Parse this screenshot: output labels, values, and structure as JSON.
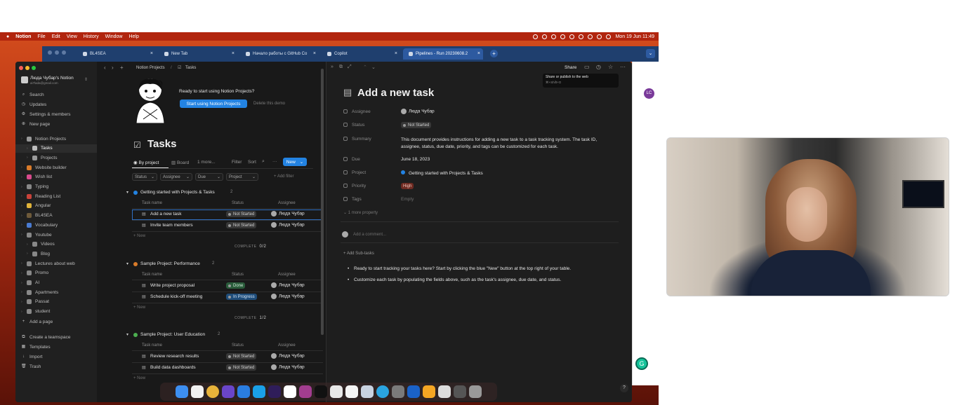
{
  "menubar": {
    "app": "Notion",
    "items": [
      "File",
      "Edit",
      "View",
      "History",
      "Window",
      "Help"
    ],
    "clock": "Mon 19 Jun  11:49"
  },
  "browser": {
    "tabs": [
      {
        "label": "BL4SEA"
      },
      {
        "label": "New Tab"
      },
      {
        "label": "Начало работы с GitHub Co"
      },
      {
        "label": "Copilot"
      },
      {
        "label": "Pipelines - Run 20230608.2"
      }
    ],
    "close_glyph": "×",
    "new_tab_glyph": "+",
    "profile_initials": "LC"
  },
  "notion": {
    "workspace": {
      "name": "Люда Чубар's Notion",
      "email": "ai7lada@gmail.com"
    },
    "sidebar_top": [
      {
        "label": "Search",
        "icon": "search-icon"
      },
      {
        "label": "Updates",
        "icon": "clock-icon"
      },
      {
        "label": "Settings & members",
        "icon": "gear-icon"
      },
      {
        "label": "New page",
        "icon": "plus-circle-icon"
      }
    ],
    "sidebar_pages": [
      {
        "label": "Notion Projects",
        "color": "#9a9a9a"
      },
      {
        "label": "Tasks",
        "color": "#bdbdbd"
      },
      {
        "label": "Projects",
        "color": "#9a9a9a"
      },
      {
        "label": "Website builder",
        "color": "#d97b2a"
      },
      {
        "label": "Wish list",
        "color": "#d94a8c"
      },
      {
        "label": "Typing",
        "color": "#888888"
      },
      {
        "label": "Reading List",
        "color": "#c9423a"
      },
      {
        "label": "Angular",
        "color": "#e0b33a"
      },
      {
        "label": "BL4SEA",
        "color": "#6e5a3a"
      },
      {
        "label": "Vocabulary",
        "color": "#4a7bd1"
      },
      {
        "label": "Youtube",
        "color": "#888888"
      },
      {
        "label": "Videos",
        "color": "#888888"
      },
      {
        "label": "Blog",
        "color": "#888888"
      },
      {
        "label": "Lectures about web",
        "color": "#888888"
      },
      {
        "label": "Promo",
        "color": "#888888"
      },
      {
        "label": "AI",
        "color": "#888888"
      },
      {
        "label": "Apartments",
        "color": "#888888"
      },
      {
        "label": "Passat",
        "color": "#888888"
      },
      {
        "label": "student",
        "color": "#888888"
      }
    ],
    "sidebar_add_page": "Add a page",
    "sidebar_bottom": [
      {
        "label": "Create a teamspace",
        "icon": "teamspace-icon"
      },
      {
        "label": "Templates",
        "icon": "templates-icon"
      },
      {
        "label": "Import",
        "icon": "import-icon"
      },
      {
        "label": "Trash",
        "icon": "trash-icon"
      }
    ],
    "breadcrumb": {
      "root": "Notion Projects",
      "sep": "/",
      "page": "Tasks"
    },
    "banner": {
      "title": "Ready to start using Notion Projects?",
      "primary": "Start using Notion Projects",
      "secondary": "Delete this demo"
    },
    "page_title": "Tasks",
    "views": {
      "active": "By project",
      "board": "Board",
      "more": "1 more...",
      "filter": "Filter",
      "sort": "Sort",
      "ellipsis": "···",
      "new": "New"
    },
    "filters": [
      "Status",
      "Assignee",
      "Due",
      "Project"
    ],
    "add_filter": "+ Add filter",
    "columns": {
      "name": "Task name",
      "status": "Status",
      "assignee": "Assignee"
    },
    "new_row": "New",
    "complete_label": "COMPLETE",
    "groups": [
      {
        "name": "Getting started with Projects & Tasks",
        "count": "2",
        "complete": "0/2",
        "tasks": [
          {
            "name": "Add a new task",
            "status": "Not Started",
            "assignee": "Люда Чубар"
          },
          {
            "name": "Invite team members",
            "status": "Not Started",
            "assignee": "Люда Чубар"
          }
        ]
      },
      {
        "name": "Sample Project: Performance",
        "count": "2",
        "complete": "1/2",
        "tasks": [
          {
            "name": "Write project proposal",
            "status": "Done",
            "assignee": "Люда Чубар"
          },
          {
            "name": "Schedule kick-off meeting",
            "status": "In Progress",
            "assignee": "Люда Чубар"
          }
        ]
      },
      {
        "name": "Sample Project: User Education",
        "count": "2",
        "complete": "",
        "tasks": [
          {
            "name": "Review research results",
            "status": "Not Started",
            "assignee": "Люда Чубар"
          },
          {
            "name": "Build data dashboards",
            "status": "Not Started",
            "assignee": "Люда Чубар"
          }
        ]
      }
    ],
    "peek": {
      "share": "Share",
      "tooltip": {
        "line1": "Share or publish to the web",
        "line2": "⌘+Shift+O"
      },
      "title": "Add a new task",
      "props": [
        {
          "label": "Assignee",
          "value": "Люда Чубар",
          "kind": "person"
        },
        {
          "label": "Status",
          "value": "Not Started",
          "kind": "status"
        },
        {
          "label": "Summary",
          "value": "This document provides instructions for adding a new task to a task tracking system. The task ID, assignee, status, due date, priority, and tags can be customized for each task.",
          "kind": "text"
        },
        {
          "label": "Due",
          "value": "June 18, 2023",
          "kind": "text"
        },
        {
          "label": "Project",
          "value": "Getting started with Projects & Tasks",
          "kind": "relation"
        },
        {
          "label": "Priority",
          "value": "High",
          "kind": "priority"
        },
        {
          "label": "Tags",
          "value": "Empty",
          "kind": "empty"
        }
      ],
      "more_props": "1 more property",
      "comment_placeholder": "Add a comment...",
      "subtasks": "Add Sub-tasks",
      "bullets": [
        "Ready to start tracking your tasks here? Start by clicking the blue \"New\" button at the top right of your table.",
        "Customize each task by populating the fields above, such as the task's assignee, due date, and status."
      ],
      "help": "?"
    }
  }
}
